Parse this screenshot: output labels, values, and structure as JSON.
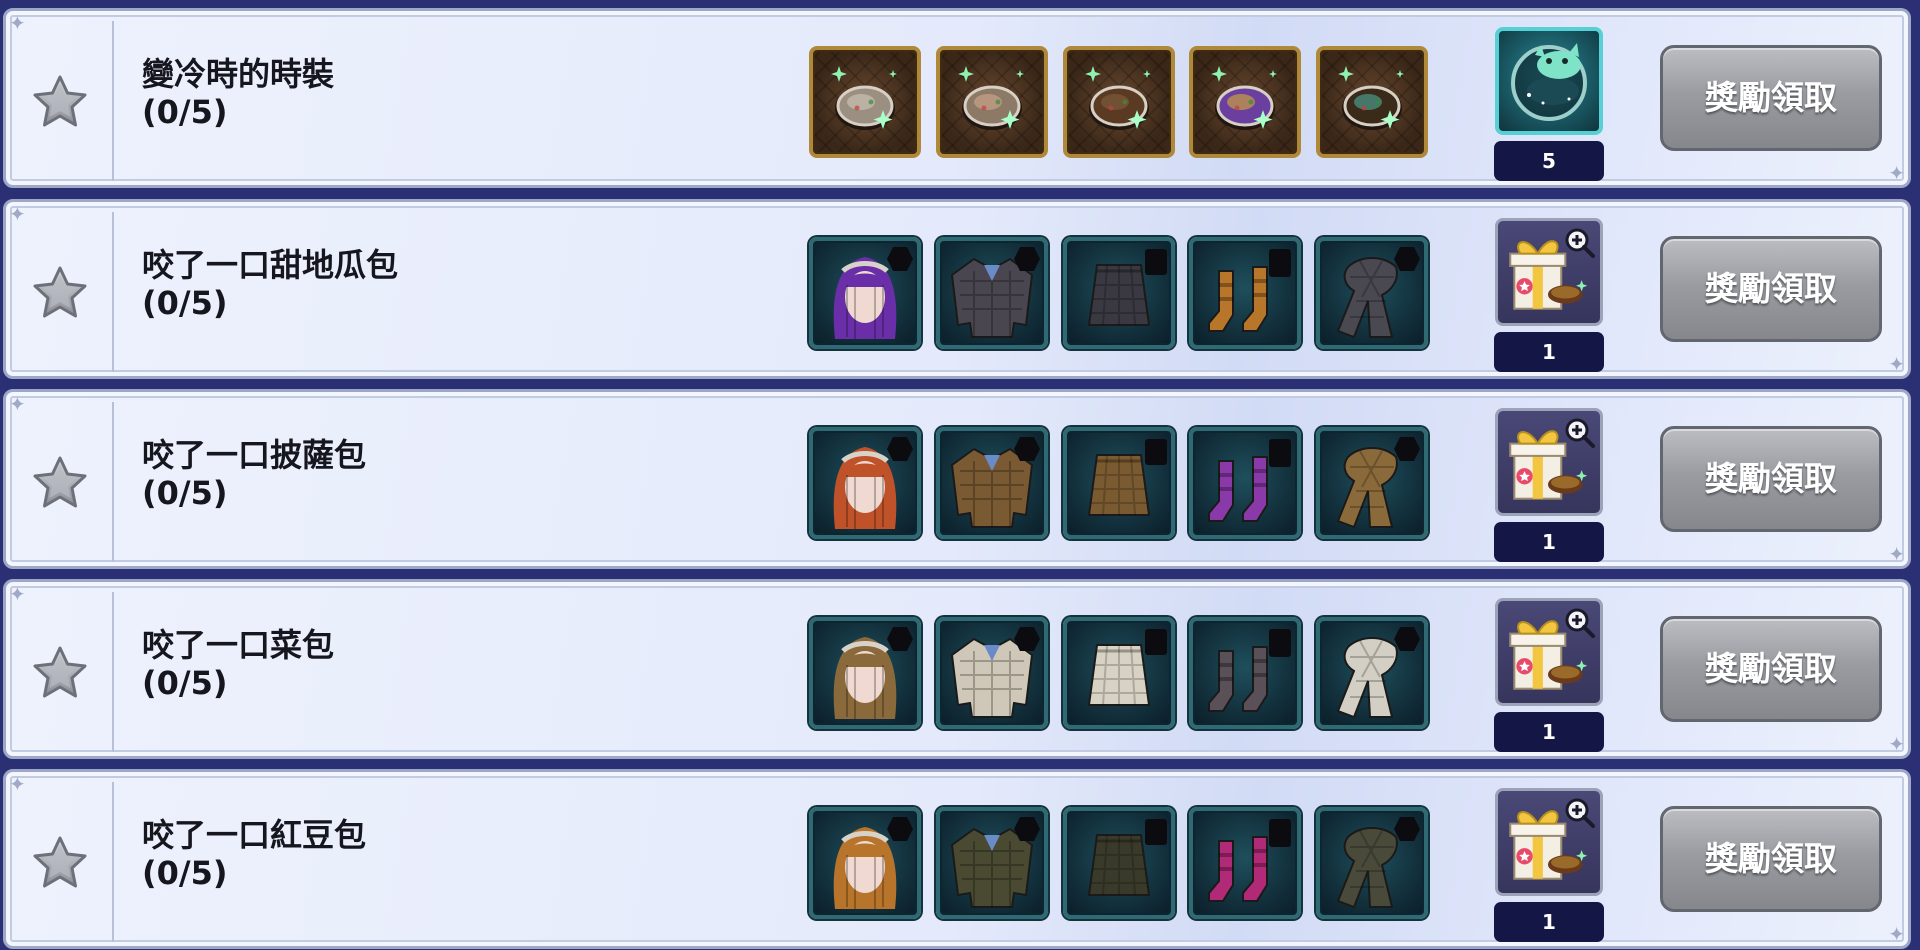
{
  "icons": {
    "star": "star-icon",
    "sparkle": "sparkle-icon",
    "magnify": "magnify-icon"
  },
  "colors": {
    "row_border": "#9da8c9",
    "claim_button": "#9a9ca2",
    "count_badge": "#141645",
    "star": "#9b9ea6"
  },
  "achievements": [
    {
      "title": "變冷時的時裝",
      "progress": "(0/5)",
      "items": [
        {
          "frame": "gold",
          "icon": "bread-fashion-icon",
          "color": "#9a8f80",
          "accent": "#c9c0b2"
        },
        {
          "frame": "gold",
          "icon": "bread-fashion-icon",
          "color": "#8d7a66",
          "accent": "#c9a38a"
        },
        {
          "frame": "gold",
          "icon": "bread-fashion-icon",
          "color": "#5a3a22",
          "accent": "#7a5a3a"
        },
        {
          "frame": "gold",
          "icon": "bread-fashion-icon",
          "color": "#6a3fa0",
          "accent": "#c8a040"
        },
        {
          "frame": "gold",
          "icon": "bread-fashion-icon",
          "color": "#3a2a1a",
          "accent": "#4a9a8a"
        }
      ],
      "reward": {
        "type": "teal",
        "icon": "sleeping-pet-icon",
        "count": "5"
      },
      "claim_label": "獎勵領取"
    },
    {
      "title": "咬了一口甜地瓜包",
      "progress": "(0/5)",
      "items": [
        {
          "frame": "teal",
          "icon": "hair-icon",
          "color": "#6a2fa8"
        },
        {
          "frame": "teal",
          "icon": "jacket-icon",
          "color": "#4a4650"
        },
        {
          "frame": "teal",
          "icon": "skirt-icon",
          "color": "#3a3840"
        },
        {
          "frame": "teal",
          "icon": "socks-icon",
          "color": "#b8762a"
        },
        {
          "frame": "teal",
          "icon": "scarf-icon",
          "color": "#4a4850"
        }
      ],
      "reward": {
        "type": "gift",
        "icon": "gift-box-icon",
        "count": "1"
      },
      "claim_label": "獎勵領取"
    },
    {
      "title": "咬了一口披薩包",
      "progress": "(0/5)",
      "items": [
        {
          "frame": "teal",
          "icon": "hair-icon",
          "color": "#c0522a"
        },
        {
          "frame": "teal",
          "icon": "jacket-icon",
          "color": "#7a5a32"
        },
        {
          "frame": "teal",
          "icon": "skirt-icon",
          "color": "#7a5a30"
        },
        {
          "frame": "teal",
          "icon": "socks-icon",
          "color": "#8a3aa8"
        },
        {
          "frame": "teal",
          "icon": "scarf-icon",
          "color": "#8a6a3a"
        }
      ],
      "reward": {
        "type": "gift",
        "icon": "gift-box-icon",
        "count": "1"
      },
      "claim_label": "獎勵領取"
    },
    {
      "title": "咬了一口菜包",
      "progress": "(0/5)",
      "items": [
        {
          "frame": "teal",
          "icon": "hair-icon",
          "color": "#8a6a3a"
        },
        {
          "frame": "teal",
          "icon": "jacket-icon",
          "color": "#cfc8b8"
        },
        {
          "frame": "teal",
          "icon": "skirt-icon",
          "color": "#d8d2c4"
        },
        {
          "frame": "teal",
          "icon": "socks-icon",
          "color": "#5a5058"
        },
        {
          "frame": "teal",
          "icon": "scarf-icon",
          "color": "#d4cfc4"
        }
      ],
      "reward": {
        "type": "gift",
        "icon": "gift-box-icon",
        "count": "1"
      },
      "claim_label": "獎勵領取"
    },
    {
      "title": "咬了一口紅豆包",
      "progress": "(0/5)",
      "items": [
        {
          "frame": "teal",
          "icon": "hair-icon",
          "color": "#b8742a"
        },
        {
          "frame": "teal",
          "icon": "jacket-icon",
          "color": "#4a4a32"
        },
        {
          "frame": "teal",
          "icon": "skirt-icon",
          "color": "#3a3a2a"
        },
        {
          "frame": "teal",
          "icon": "socks-icon",
          "color": "#b02a78"
        },
        {
          "frame": "teal",
          "icon": "scarf-icon",
          "color": "#4a4a3a"
        }
      ],
      "reward": {
        "type": "gift",
        "icon": "gift-box-icon",
        "count": "1"
      },
      "claim_label": "獎勵領取"
    }
  ]
}
